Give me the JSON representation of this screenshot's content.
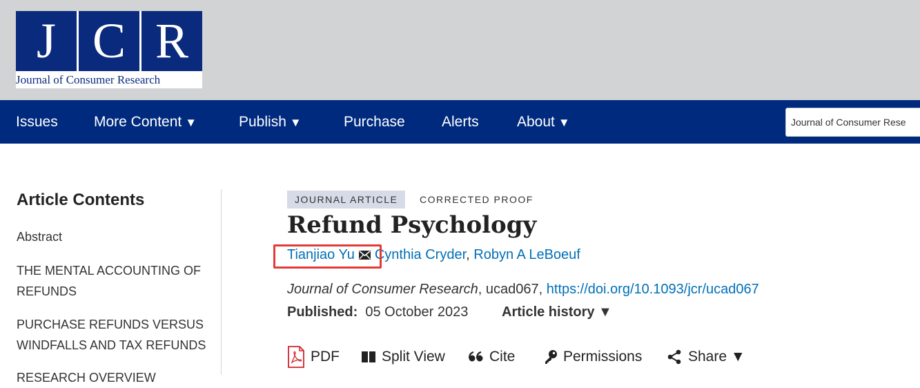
{
  "logo": {
    "letters": [
      "J",
      "C",
      "R"
    ],
    "subtitle": "Journal of Consumer Research",
    "brand_color": "#0a2a7e"
  },
  "nav": {
    "items": [
      {
        "label": "Issues",
        "has_menu": false
      },
      {
        "label": "More Content",
        "has_menu": true
      },
      {
        "label": "Publish",
        "has_menu": true
      },
      {
        "label": "Purchase",
        "has_menu": false
      },
      {
        "label": "Alerts",
        "has_menu": false
      },
      {
        "label": "About",
        "has_menu": true
      }
    ],
    "caret": "▼",
    "search_value": "Journal of Consumer Rese",
    "background": "#002a7e"
  },
  "sidebar": {
    "title": "Article Contents",
    "items": [
      "Abstract",
      "THE MENTAL ACCOUNTING OF REFUNDS",
      "PURCHASE REFUNDS VERSUS WINDFALLS AND TAX REFUNDS",
      "RESEARCH OVERVIEW"
    ]
  },
  "article": {
    "type_badge": "JOURNAL ARTICLE",
    "status": "CORRECTED PROOF",
    "title": "Refund Psychology",
    "authors": [
      "Tianjiao Yu",
      "Cynthia Cryder",
      "Robyn A LeBoeuf"
    ],
    "author_separator": ",",
    "journal": "Journal of Consumer Research",
    "article_id": ", ucad067, ",
    "doi": "https://doi.org/10.1093/jcr/ucad067",
    "published_label": "Published:",
    "published_date": "05 October 2023",
    "history_label": "Article history ▼",
    "link_color": "#006fb7",
    "highlight_color": "#e53935"
  },
  "toolbar": {
    "pdf": "PDF",
    "split_view": "Split View",
    "cite": "Cite",
    "permissions": "Permissions",
    "share": "Share ▼"
  }
}
